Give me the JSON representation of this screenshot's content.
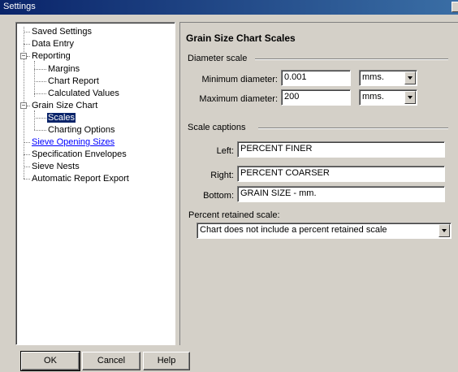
{
  "window": {
    "title": "Settings"
  },
  "tree": {
    "items": [
      {
        "label": "Saved Settings"
      },
      {
        "label": "Data Entry"
      },
      {
        "label": "Reporting",
        "expander": "−"
      },
      {
        "label": "Margins"
      },
      {
        "label": "Chart Report"
      },
      {
        "label": "Calculated Values"
      },
      {
        "label": "Grain Size Chart",
        "expander": "−"
      },
      {
        "label": "Scales",
        "state": "selected"
      },
      {
        "label": "Charting Options"
      },
      {
        "label": "Sieve Opening Sizes",
        "state": "link"
      },
      {
        "label": "Specification Envelopes"
      },
      {
        "label": "Sieve Nests"
      },
      {
        "label": "Automatic Report Export"
      }
    ]
  },
  "panel": {
    "heading": "Grain Size Chart Scales",
    "diameter_group": "Diameter scale",
    "min_label": "Minimum diameter:",
    "min_value": "0.001",
    "min_unit": "mms.",
    "max_label": "Maximum diameter:",
    "max_value": "200",
    "max_unit": "mms.",
    "captions_group": "Scale captions",
    "left_label": "Left:",
    "left_value": "PERCENT FINER",
    "right_label": "Right:",
    "right_value": "PERCENT COARSER",
    "bottom_label": "Bottom:",
    "bottom_value": "GRAIN SIZE - mm.",
    "retained_label": "Percent retained scale:",
    "retained_value": "Chart does not include a percent retained scale"
  },
  "buttons": {
    "ok": "OK",
    "cancel": "Cancel",
    "help": "Help"
  }
}
